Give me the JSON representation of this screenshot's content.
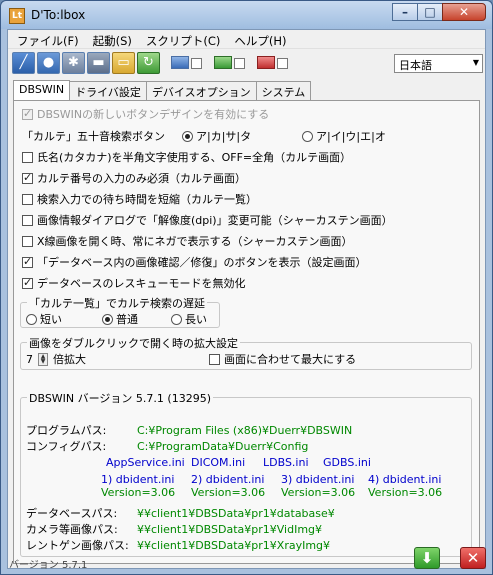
{
  "window": {
    "title": "D'To:lbox",
    "app_icon": "Lt"
  },
  "menubar": {
    "items": [
      "ファイル(F)",
      "起動(S)",
      "スクリプト(C)",
      "ヘルプ(H)"
    ]
  },
  "toolbar": {
    "language": "日本語"
  },
  "tabs": [
    "DBSWIN",
    "ドライバ設定",
    "デバイスオプション",
    "システム"
  ],
  "dbswin": {
    "new_button_design": "DBSWINの新しいボタンデザインを有効にする",
    "karte_search_label": "「カルテ」五十音検索ボタン",
    "karte_search_opt1": "ア|カ|サ|タ",
    "karte_search_opt2": "ア|イ|ウ|エ|オ",
    "opt_halfwidth": "氏名(カタカナ)を半角文字使用する、OFF=全角（カルテ画面）",
    "opt_numeric_only": "カルテ番号の入力のみ必須（カルテ画面）",
    "opt_shorten_wait": "検索入力での待ち時間を短縮（カルテ一覧）",
    "opt_dpi": "画像情報ダイアログで「解像度(dpi)」変更可能（シャーカステン画面）",
    "opt_xray_negative": "X線画像を開く時、常にネガで表示する（シャーカステン画面）",
    "opt_show_db_button": "「データベース内の画像確認／修復」のボタンを表示（設定画面）",
    "opt_disable_rescue": "データベースのレスキューモードを無効化",
    "delay_group_title": "「カルテ一覧」でカルテ検索の遅延",
    "delay_short": "短い",
    "delay_normal": "普通",
    "delay_long": "長い",
    "zoom_group_title": "画像をダブルクリックで開く時の拡大設定",
    "zoom_value": "7",
    "zoom_unit": "倍拡大",
    "zoom_fit_label": "画面に合わせて最大にする",
    "info_group_title": "DBSWIN バージョン 5.7.1 (13295)",
    "program_path_label": "プログラムパス:",
    "program_path": "C:¥Program Files (x86)¥Duerr¥DBSWIN",
    "config_path_label": "コンフィグパス:",
    "config_path": "C:¥ProgramData¥Duerr¥Config",
    "ini_files": [
      "AppService.ini",
      "DICOM.ini",
      "LDBS.ini",
      "GDBS.ini"
    ],
    "dbident": [
      {
        "name": "1) dbident.ini",
        "version": "Version=3.06"
      },
      {
        "name": "2) dbident.ini",
        "version": "Version=3.06"
      },
      {
        "name": "3) dbident.ini",
        "version": "Version=3.06"
      },
      {
        "name": "4) dbident.ini",
        "version": "Version=3.06"
      }
    ],
    "db_path_label": "データベースパス:",
    "db_path": "¥¥client1¥DBSData¥pr1¥database¥",
    "camera_path_label": "カメラ等画像パス:",
    "camera_path": "¥¥client1¥DBSData¥pr1¥VidImg¥",
    "xray_path_label": "レントゲン画像パス:",
    "xray_path": "¥¥client1¥DBSData¥pr1¥XrayImg¥"
  },
  "footer": {
    "version": "バージョン 5.7.1"
  },
  "colors": {
    "path_green": "#008800",
    "ini_blue": "#0000cc"
  }
}
